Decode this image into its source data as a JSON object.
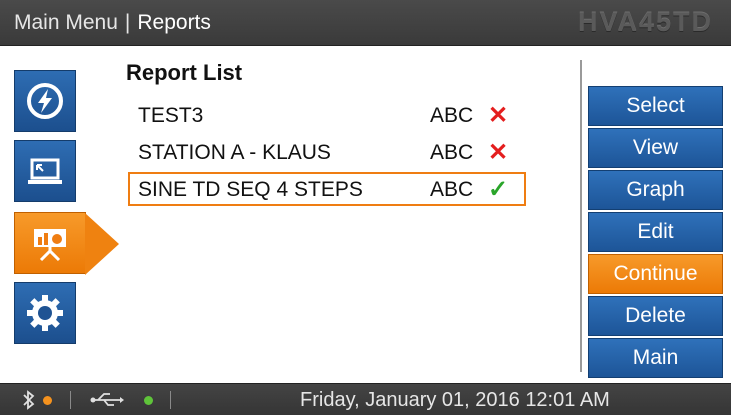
{
  "header": {
    "breadcrumb_root": "Main Menu",
    "breadcrumb_separator": "|",
    "breadcrumb_current": "Reports",
    "model": "HVA45TD"
  },
  "sidebar": {
    "items": [
      {
        "icon": "lightning-icon",
        "active": false
      },
      {
        "icon": "laptop-icon",
        "active": false
      },
      {
        "icon": "presentation-chart-icon",
        "active": true
      },
      {
        "icon": "gear-icon",
        "active": false
      }
    ]
  },
  "report_list": {
    "title": "Report List",
    "rows": [
      {
        "name": "TEST3",
        "tag": "ABC",
        "status": "✕",
        "selected": false
      },
      {
        "name": "STATION A - KLAUS",
        "tag": "ABC",
        "status": "✕",
        "selected": false
      },
      {
        "name": "SINE TD SEQ 4 STEPS",
        "tag": "ABC",
        "status": "✓",
        "selected": true
      }
    ]
  },
  "actions": {
    "select": "Select",
    "view": "View",
    "graph": "Graph",
    "edit": "Edit",
    "continue": "Continue",
    "delete": "Delete",
    "main": "Main",
    "active": "continue"
  },
  "statusbar": {
    "bluetooth_icon": "bluetooth-icon",
    "bluetooth_status_color": "#f5921e",
    "usb_icon": "usb-icon",
    "usb_status_color": "#5fc43a",
    "datetime": "Friday, January 01, 2016 12:01 AM"
  },
  "colors": {
    "accent_blue": "#2f71ba",
    "accent_orange": "#ef7d12",
    "error_red": "#e41e1e",
    "ok_green": "#2aa52a"
  }
}
